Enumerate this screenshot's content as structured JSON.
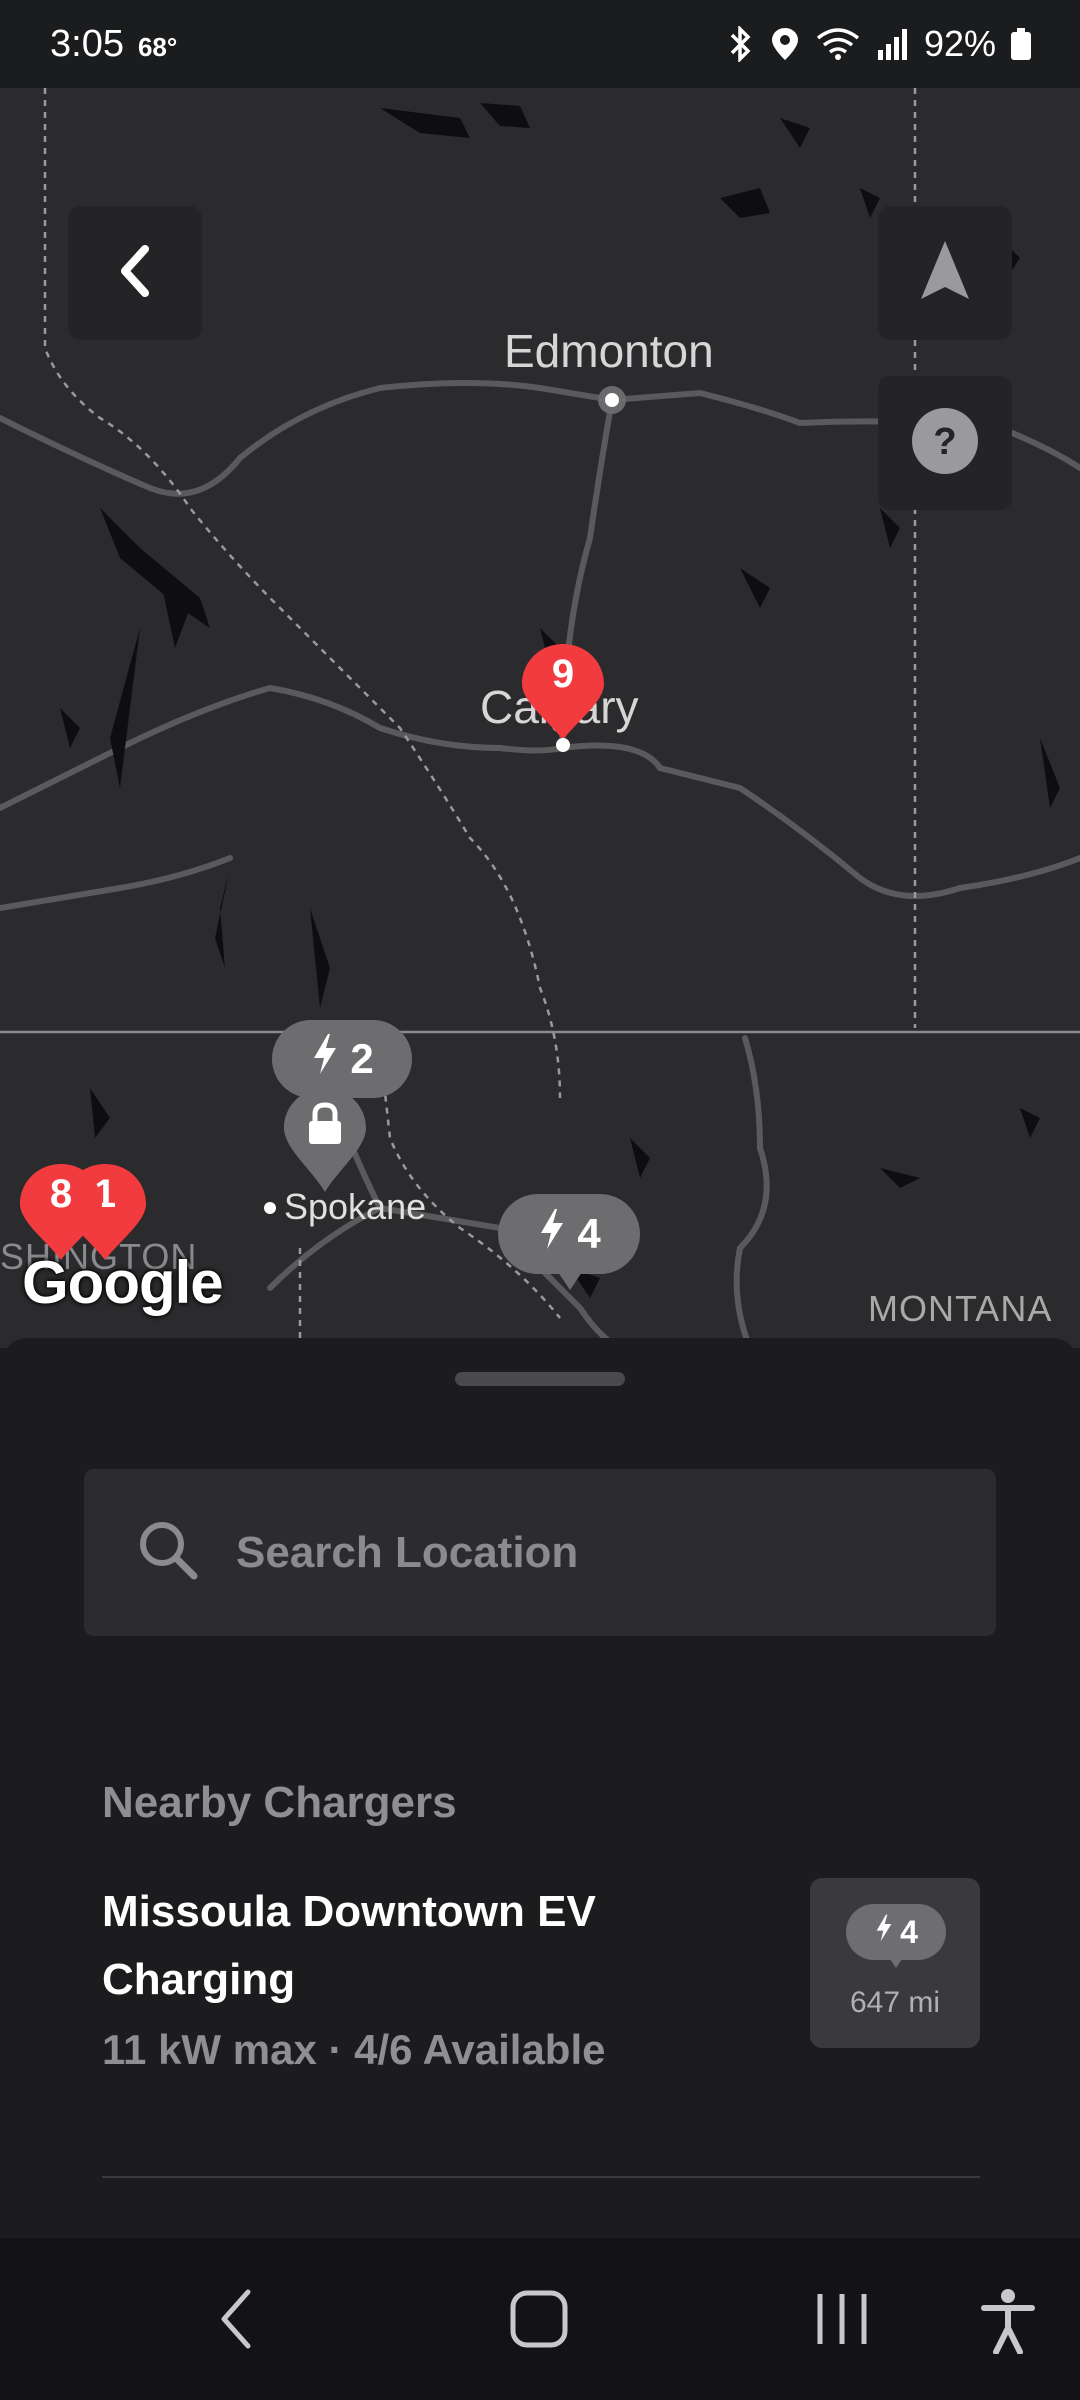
{
  "status_bar": {
    "time": "3:05",
    "temperature": "68°",
    "battery": "92%"
  },
  "map": {
    "cities": {
      "edmonton": "Edmonton",
      "calgary": "Calgary",
      "spokane": "Spokane"
    },
    "region_label": "MONTANA",
    "partial_label": "SHINGTON",
    "attribution": "Google",
    "red_pins": [
      {
        "count": "9"
      },
      {
        "count": "8"
      },
      {
        "count": "1"
      }
    ],
    "charger_bubbles": [
      {
        "count": "2"
      },
      {
        "count": "4"
      }
    ],
    "icons": {
      "back": "chevron-left-icon",
      "locate": "navigation-arrow-icon",
      "help": "question-icon",
      "lock": "lock-icon"
    },
    "colors": {
      "pin_red": "#f23b3f",
      "bubble_grey": "#6d6d70",
      "map_bg": "#2b2b2d"
    }
  },
  "sheet": {
    "search_placeholder": "Search Location",
    "section_title": "Nearby Chargers",
    "chargers": [
      {
        "name": "Missoula Downtown EV Charging",
        "detail": "11 kW max · 4/6 Available",
        "stalls": "4",
        "distance": "647 mi"
      }
    ]
  }
}
